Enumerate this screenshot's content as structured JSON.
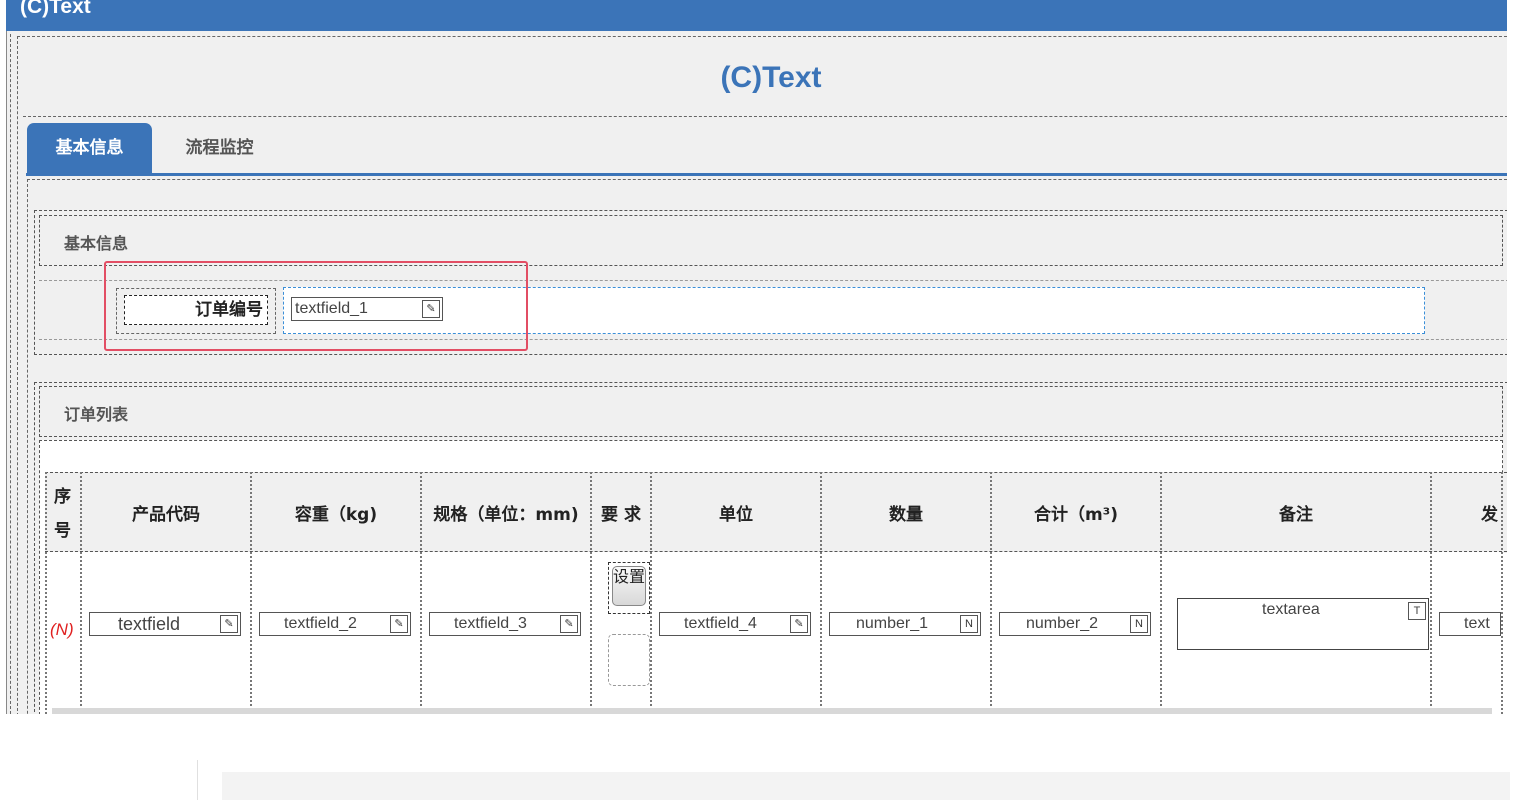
{
  "window": {
    "title": "(C)Text"
  },
  "form": {
    "title": "(C)Text"
  },
  "tabs": [
    {
      "label": "基本信息",
      "active": true
    },
    {
      "label": "流程监控",
      "active": false
    }
  ],
  "section_basic": {
    "title": "基本信息",
    "order_no_label": "订单编号",
    "order_no_field": "textfield_1"
  },
  "section_list": {
    "title": "订单列表",
    "seq_header": [
      "序",
      "号"
    ],
    "headers": [
      "产品代码",
      "容重（kg)",
      "规格（单位：mm)",
      "要 求",
      "单位",
      "数量",
      "合计（m³)",
      "备注",
      "发"
    ],
    "row_marker": "(N)",
    "cells": {
      "c1": "textfield",
      "c2": "textfield_2",
      "c3": "textfield_3",
      "c5": "textfield_4",
      "c6": "number_1",
      "c7": "number_2",
      "c8": "textarea",
      "c9": "text"
    },
    "set_button": "设置"
  },
  "icons": {
    "textfield": "edit-icon",
    "number": "number-icon",
    "textarea": "textarea-icon"
  },
  "colors": {
    "brand": "#3b74b8",
    "highlight": "#e24e64",
    "marker": "#e02020"
  }
}
